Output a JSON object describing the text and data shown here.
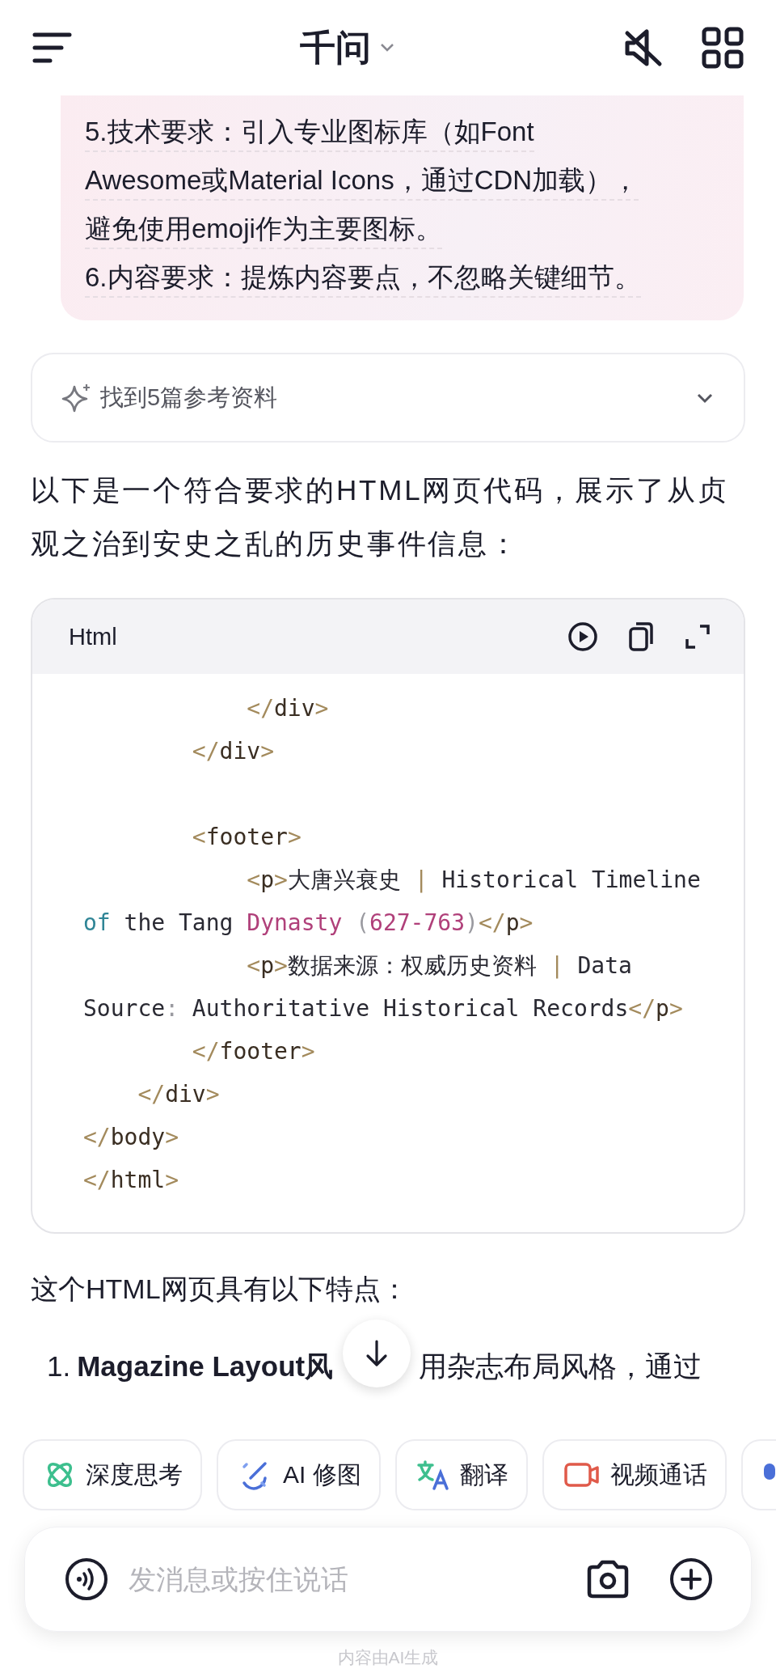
{
  "header": {
    "title": "千问"
  },
  "user_message": {
    "lines": [
      "5.技术要求：引入专业图标库（如Font",
      "Awesome或Material Icons，通过CDN加载），",
      "避免使用emoji作为主要图标。",
      "6.内容要求：提炼内容要点，不忽略关键细节。"
    ]
  },
  "references": {
    "label": "找到5篇参考资料",
    "expanded": false
  },
  "intro": "以下是一个符合要求的HTML网页代码，展示了从贞观之治到安史之乱的历史事件信息：",
  "code_block": {
    "language": "Html",
    "lines": [
      {
        "segments": [
          {
            "text": "            </",
            "kind": "tag"
          },
          {
            "text": "div",
            "kind": "name"
          },
          {
            "text": ">",
            "kind": "tag"
          }
        ]
      },
      {
        "segments": [
          {
            "text": "        </",
            "kind": "tag"
          },
          {
            "text": "div",
            "kind": "name"
          },
          {
            "text": ">",
            "kind": "tag"
          }
        ]
      },
      {
        "kind": "blank"
      },
      {
        "segments": [
          {
            "text": "        <",
            "kind": "tag"
          },
          {
            "text": "footer",
            "kind": "name"
          },
          {
            "text": ">",
            "kind": "tag"
          }
        ]
      },
      {
        "segments": [
          {
            "text": "            <",
            "kind": "tag"
          },
          {
            "text": "p",
            "kind": "name"
          },
          {
            "text": ">",
            "kind": "tag"
          },
          {
            "text": "大唐兴衰史 ",
            "kind": "plain"
          },
          {
            "text": "|",
            "kind": "tag"
          },
          {
            "text": " Historical Timeline",
            "kind": "plain"
          }
        ]
      },
      {
        "segments": [
          {
            "text": "of",
            "kind": "keyword"
          },
          {
            "text": " the Tang ",
            "kind": "plain"
          },
          {
            "text": "Dynasty",
            "kind": "string"
          },
          {
            "text": " (",
            "kind": "punct"
          },
          {
            "text": "627-763",
            "kind": "string"
          },
          {
            "text": ")",
            "kind": "punct"
          },
          {
            "text": "</",
            "kind": "tag"
          },
          {
            "text": "p",
            "kind": "name"
          },
          {
            "text": ">",
            "kind": "tag"
          }
        ]
      },
      {
        "segments": [
          {
            "text": "            <",
            "kind": "tag"
          },
          {
            "text": "p",
            "kind": "name"
          },
          {
            "text": ">",
            "kind": "tag"
          },
          {
            "text": "数据来源：权威历史资料 ",
            "kind": "plain"
          },
          {
            "text": "|",
            "kind": "tag"
          },
          {
            "text": " Data",
            "kind": "plain"
          }
        ]
      },
      {
        "segments": [
          {
            "text": "Source",
            "kind": "plain"
          },
          {
            "text": ":",
            "kind": "punct"
          },
          {
            "text": " Authoritative Historical Records",
            "kind": "plain"
          },
          {
            "text": "</",
            "kind": "tag"
          },
          {
            "text": "p",
            "kind": "name"
          },
          {
            "text": ">",
            "kind": "tag"
          }
        ]
      },
      {
        "segments": [
          {
            "text": "        </",
            "kind": "tag"
          },
          {
            "text": "footer",
            "kind": "name"
          },
          {
            "text": ">",
            "kind": "tag"
          }
        ]
      },
      {
        "segments": [
          {
            "text": "    </",
            "kind": "tag"
          },
          {
            "text": "div",
            "kind": "name"
          },
          {
            "text": ">",
            "kind": "tag"
          }
        ]
      },
      {
        "segments": [
          {
            "text": "</",
            "kind": "tag"
          },
          {
            "text": "body",
            "kind": "name"
          },
          {
            "text": ">",
            "kind": "tag"
          }
        ]
      },
      {
        "segments": [
          {
            "text": "</",
            "kind": "tag"
          },
          {
            "text": "html",
            "kind": "name"
          },
          {
            "text": ">",
            "kind": "tag"
          }
        ]
      }
    ]
  },
  "summary_heading": "这个HTML网页具有以下特点：",
  "list_items": [
    {
      "marker": "1.",
      "title": "Magazine Layout风",
      "text": "用杂志布局风格，通过"
    }
  ],
  "chips": [
    {
      "label": "深度思考"
    },
    {
      "label": "AI 修图"
    },
    {
      "label": "翻译"
    },
    {
      "label": "视频通话"
    }
  ],
  "input": {
    "placeholder": "发消息或按住说话"
  },
  "disclaimer": "内容由AI生成"
}
